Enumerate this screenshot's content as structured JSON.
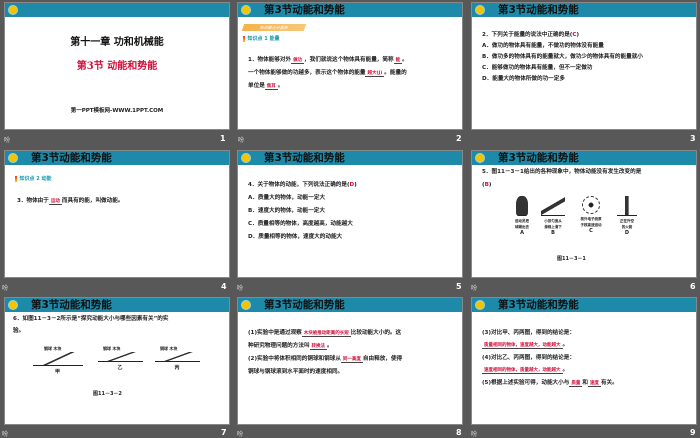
{
  "section_title": "第3节动能和势能",
  "anim_icon": "吩",
  "slides": [
    {
      "number": "1",
      "chapter": "第十一章  功和机械能",
      "section": "第3节  动能和势能",
      "site": "第一PPT模板网-WWW.1PPT.COM"
    },
    {
      "number": "2",
      "banner": "知识要点分类练",
      "kp": "知识点 1  能量",
      "l1a": "1．物体能够对外",
      "b1": "做功",
      "l1b": "，我们就说这个物体具有能量，简称",
      "b2": "能",
      "l1c": "。",
      "l2a": "一个物体能够做的功越多，表示这个物体的能量",
      "b3": "越大(J)",
      "l2b": "。能量的",
      "l3a": "单位是",
      "b4": "焦耳",
      "l3b": "。"
    },
    {
      "number": "3",
      "q": "2．下列关于能量的说法中正确的是(",
      "ans": "C",
      "qend": ")",
      "opts": [
        "A．做功的物体具有能量，不做功的物体没有能量",
        "B．做功多的物体具有的能量就大，做功少的物体具有的能量就小",
        "C．能够做功的物体具有能量，但不一定做功",
        "D．能量大的物体所做的功一定多"
      ]
    },
    {
      "number": "4",
      "kp": "知识点 2  动能",
      "la": "3．物体由于",
      "b": "运动",
      "lb": "而具有的能，叫做动能。"
    },
    {
      "number": "5",
      "q": "4．关于物体的动能，下列说法正确的是(",
      "ans": "D",
      "qend": ")",
      "opts": [
        "A．质量大的物体，动能一定大",
        "B．速度大的物体，动能一定大",
        "C．质量相等的物体，高度越高，动能越大",
        "D．质量相等的物体，速度大的动能大"
      ]
    },
    {
      "number": "6",
      "q": "5．图11－3－1给出的各种现象中，物体动能没有发生改变的是",
      "ans": "B",
      "figs": [
        {
          "cap": "运动员把\n球踢出去",
          "letter": "A"
        },
        {
          "cap": "小孩匀速从\n滑梯上滑下",
          "letter": "B"
        },
        {
          "cap": "核外电子绕原\n子核高速运动",
          "letter": "C"
        },
        {
          "cap": "正在升空\n的火箭",
          "letter": "D"
        }
      ],
      "figcap": "图11－3－1"
    },
    {
      "number": "7",
      "q1": "6．如图11－3－2所示是“探究动能大小与哪些因素有关”的实",
      "q2": "验。",
      "figs": [
        {
          "ball": "钢球",
          "block": "木块",
          "h": "h",
          "label": "甲"
        },
        {
          "ball": "钢球",
          "block": "木块",
          "h": "h",
          "label": "乙"
        },
        {
          "ball": "铜球",
          "block": "木块",
          "h": "h",
          "label": "丙"
        }
      ],
      "figcap": "图11－3－2"
    },
    {
      "number": "8",
      "l1a": "(1)实验中是通过观察",
      "b1": "木块被推动距离的长短",
      "l1b": "比较动能大小的。这",
      "l2a": "种研究物理问题的方法叫",
      "b2": "转换法",
      "l2b": "。",
      "l3a": "(2)实验中将体积相同的铜球和钢球从",
      "b3": "同一高度",
      "l3b": "自由释放，使得",
      "l4": "铜球与钢球滚到水平面时的速度相同。"
    },
    {
      "number": "9",
      "l1": "(3)对比甲、丙两图，得到的结论是：",
      "b1": "质量相同的物体，速度越大，动能越大",
      "l2": "(4)对比乙、丙两图，得到的结论是：",
      "b2": "速度相同的物体，质量越大，动能越大",
      "l3a": "(5)根据上述实验可得，动能大小与",
      "b3": "质量",
      "l3b": "和",
      "b4": "速度",
      "l3c": "有关。"
    }
  ]
}
